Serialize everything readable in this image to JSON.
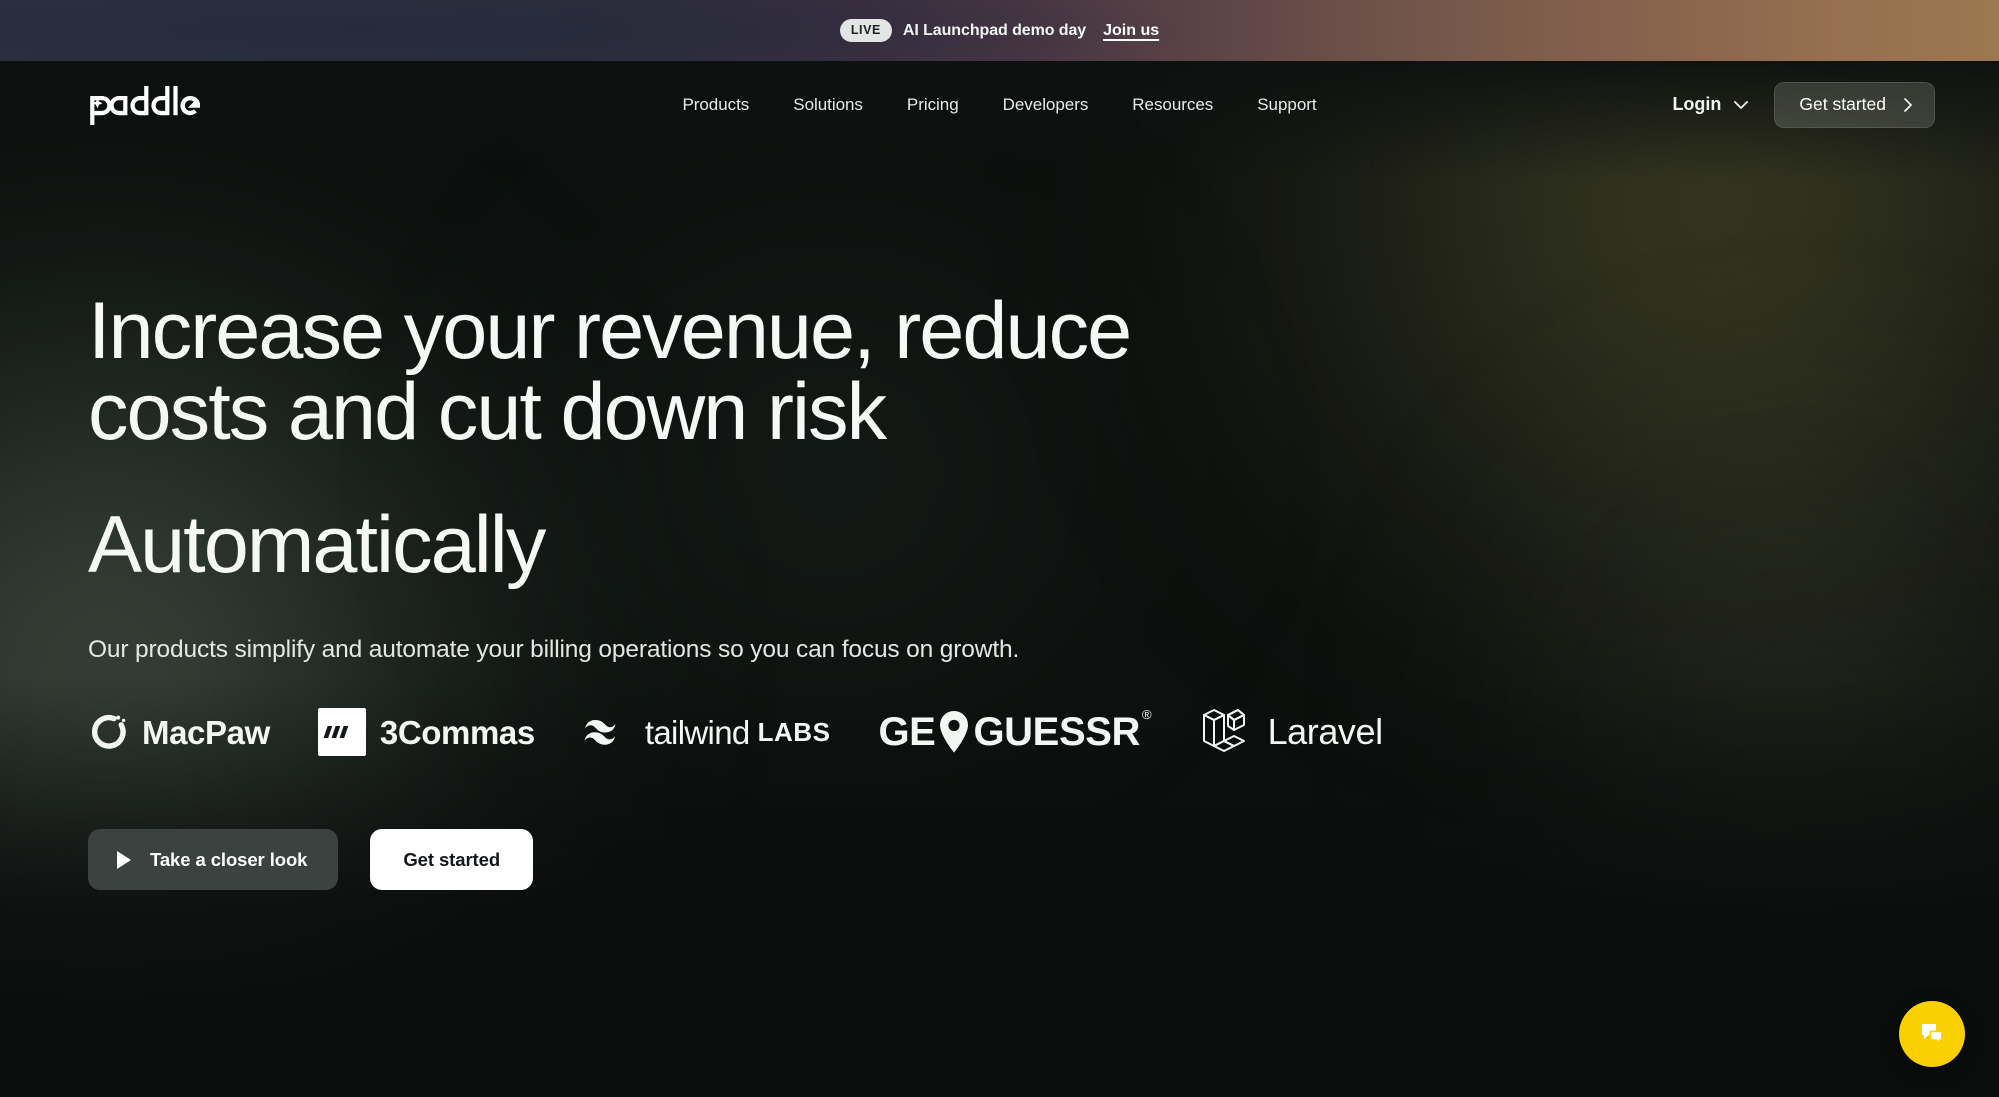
{
  "announcement": {
    "badge": "LIVE",
    "text": "AI Launchpad demo day",
    "link_label": "Join us"
  },
  "nav": {
    "logo_text": "paddle",
    "links": [
      {
        "label": "Products"
      },
      {
        "label": "Solutions"
      },
      {
        "label": "Pricing"
      },
      {
        "label": "Developers"
      },
      {
        "label": "Resources"
      },
      {
        "label": "Support"
      }
    ],
    "login_label": "Login",
    "login_icon": "chevron-down-icon",
    "cta_label": "Get started",
    "cta_icon": "chevron-right-icon"
  },
  "hero": {
    "headline_line_1": "Increase your revenue, reduce",
    "headline_line_2": "costs and cut down risk",
    "headline_accent": "Automatically",
    "subhead": "Our products simplify and automate your billing operations so you can focus on growth.",
    "buttons": {
      "secondary_label": "Take a closer look",
      "secondary_icon": "play-icon",
      "primary_label": "Get started"
    }
  },
  "logo_strip": {
    "brands": [
      {
        "name": "MacPaw",
        "icon": "macpaw-icon"
      },
      {
        "name": "3Commas",
        "icon": "3commas-icon"
      },
      {
        "name": "tailwind",
        "suffix": "LABS",
        "icon": "tailwind-icon"
      },
      {
        "name": "GEOGUESSR",
        "icon": "geoguessr-pin-icon",
        "trademark": "®"
      },
      {
        "name": "Laravel",
        "icon": "laravel-icon"
      }
    ]
  },
  "chat": {
    "icon": "chat-bubble-icon",
    "accent_color": "#fad000"
  },
  "colors": {
    "page_bg": "#0c100e",
    "text_primary": "#f6f8f5",
    "text_secondary": "#e4e8e4",
    "cta_primary_bg": "#ffffff",
    "cta_secondary_bg": "#3c4240",
    "chat_yellow": "#fad000",
    "banner_left": "#2c3141",
    "banner_right": "#9c7850"
  }
}
